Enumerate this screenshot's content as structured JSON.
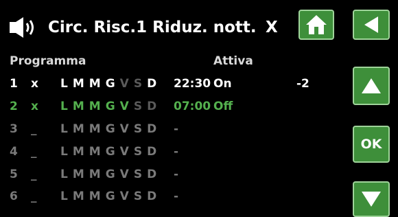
{
  "header": {
    "title": "Circ. Risc.1 Riduz. nott.",
    "close_label": "X"
  },
  "columns": {
    "program": "Programma",
    "active": "Attiva"
  },
  "rows": [
    {
      "num": "1",
      "active": "x",
      "days": [
        "L",
        "M",
        "M",
        "G",
        "V",
        "S",
        "D"
      ],
      "days_on": [
        true,
        true,
        true,
        true,
        false,
        false,
        true
      ],
      "time": "22:30",
      "state": "On",
      "value": "-2",
      "style": "white"
    },
    {
      "num": "2",
      "active": "x",
      "days": [
        "L",
        "M",
        "M",
        "G",
        "V",
        "S",
        "D"
      ],
      "days_on": [
        true,
        true,
        true,
        true,
        true,
        false,
        false
      ],
      "time": "07:00",
      "state": "Off",
      "value": "",
      "style": "green"
    },
    {
      "num": "3",
      "active": "_",
      "days": [
        "L",
        "M",
        "M",
        "G",
        "V",
        "S",
        "D"
      ],
      "days_on": [
        false,
        false,
        false,
        false,
        false,
        false,
        false
      ],
      "time": "-",
      "state": "",
      "value": "",
      "style": "dim"
    },
    {
      "num": "4",
      "active": "_",
      "days": [
        "L",
        "M",
        "M",
        "G",
        "V",
        "S",
        "D"
      ],
      "days_on": [
        false,
        false,
        false,
        false,
        false,
        false,
        false
      ],
      "time": "-",
      "state": "",
      "value": "",
      "style": "dim"
    },
    {
      "num": "5",
      "active": "_",
      "days": [
        "L",
        "M",
        "M",
        "G",
        "V",
        "S",
        "D"
      ],
      "days_on": [
        false,
        false,
        false,
        false,
        false,
        false,
        false
      ],
      "time": "-",
      "state": "",
      "value": "",
      "style": "dim"
    },
    {
      "num": "6",
      "active": "_",
      "days": [
        "L",
        "M",
        "M",
        "G",
        "V",
        "S",
        "D"
      ],
      "days_on": [
        false,
        false,
        false,
        false,
        false,
        false,
        false
      ],
      "time": "-",
      "state": "",
      "value": "",
      "style": "dim"
    }
  ],
  "buttons": {
    "ok_label": "OK"
  },
  "icons": {
    "speaker": "speaker-icon",
    "home": "home-icon",
    "back": "back-arrow-icon",
    "up": "up-arrow-icon",
    "down": "down-arrow-icon"
  },
  "colors": {
    "accent": "#3e8f3a",
    "active_row": "#54b04e",
    "inactive": "#7a7a7a",
    "background": "#000000"
  }
}
